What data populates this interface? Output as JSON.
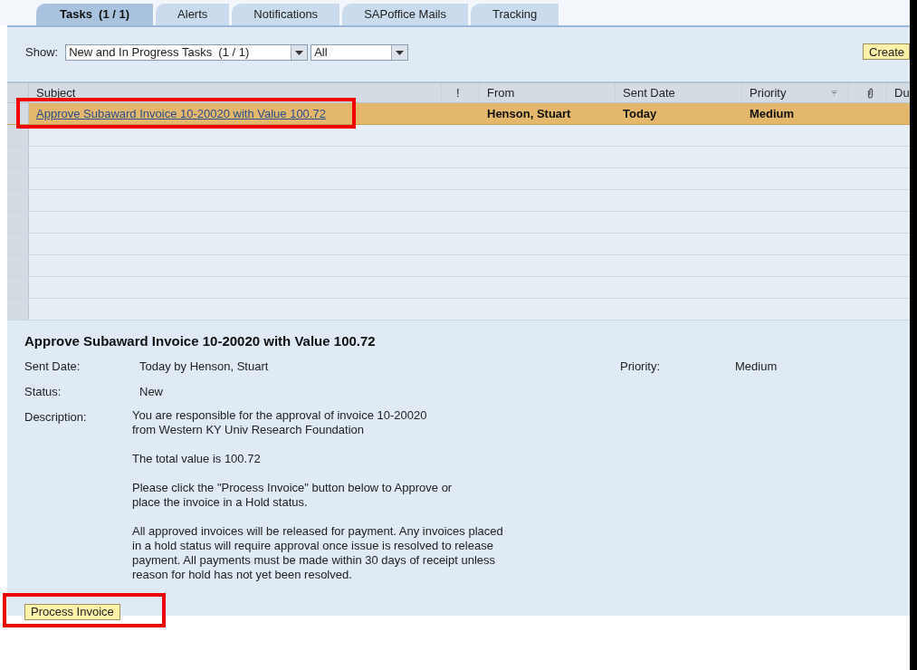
{
  "tabs": [
    {
      "label": "Tasks  (1 / 1)",
      "selected": true
    },
    {
      "label": "Alerts",
      "selected": false
    },
    {
      "label": "Notifications",
      "selected": false
    },
    {
      "label": "SAPoffice Mails",
      "selected": false
    },
    {
      "label": "Tracking",
      "selected": false
    }
  ],
  "toolbar": {
    "show_label": "Show:",
    "filter_value": "New and In Progress Tasks  (1 / 1)",
    "scope_value": "All",
    "create_button": "Create"
  },
  "table": {
    "columns": [
      "Subject",
      "!",
      "From",
      "Sent Date",
      "Priority",
      "",
      "Du"
    ],
    "rows": [
      {
        "subject": "Approve Subaward Invoice 10-20020 with Value 100.72",
        "from": "Henson, Stuart",
        "sent_date": "Today",
        "priority": "Medium",
        "selected": true
      }
    ]
  },
  "detail": {
    "title": "Approve Subaward Invoice 10-20020 with Value 100.72",
    "sent_date_label": "Sent Date:",
    "sent_date": "Today by Henson, Stuart",
    "priority_label": "Priority:",
    "priority": "Medium",
    "status_label": "Status:",
    "status": "New",
    "description_label": "Description:",
    "description": [
      "You are responsible for the approval of invoice 10-20020\nfrom Western KY Univ Research Foundation",
      "The total value is 100.72",
      "Please click the \"Process Invoice\" button below to Approve or\nplace the invoice in a Hold status.",
      "All approved invoices will be released for payment. Any invoices placed\nin a hold status will require approval once issue is resolved to release\npayment. All payments must be made within 30 days of receipt unless\nreason for hold has not yet been resolved."
    ],
    "process_button": "Process Invoice"
  }
}
